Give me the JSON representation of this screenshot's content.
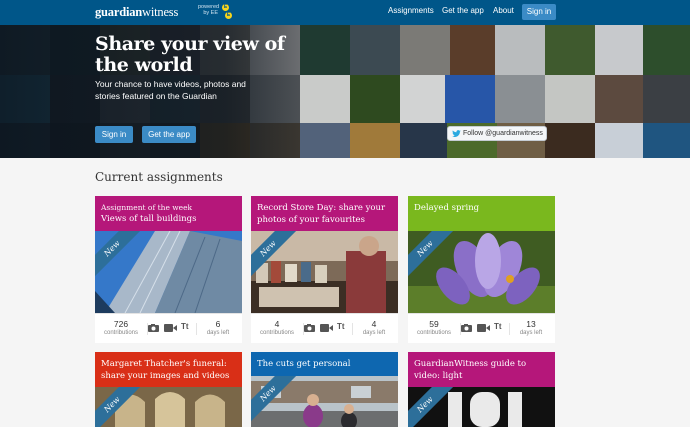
{
  "topbar": {
    "logo_bold": "guardian",
    "logo_thin": "witness",
    "powered_by": "powered by EE",
    "ee_letters": [
      "E",
      "E"
    ],
    "nav": [
      "Assignments",
      "Get the app",
      "About"
    ],
    "signin": "Sign in"
  },
  "hero": {
    "title": "Share your view of the world",
    "subtitle": "Your chance to have videos, photos and stories featured on the Guardian",
    "signin": "Sign in",
    "get_app": "Get the app",
    "follow": "Follow @guardianwitness"
  },
  "section_title": "Current assignments",
  "colors": {
    "topbar": "#005689",
    "button": "#3b8bc6",
    "magenta": "#b5177a",
    "green": "#7ab81e",
    "red": "#d92f17",
    "blue": "#0e67b0"
  },
  "cards": [
    {
      "week": "Assignment of the week",
      "title": "Views of tall buildings",
      "badge": "New",
      "contributions": "726",
      "contributions_label": "contributions",
      "days": "6",
      "days_label": "days left",
      "media": "Tt"
    },
    {
      "week": "",
      "title": "Record Store Day: share your photos of your favourites",
      "badge": "New",
      "contributions": "4",
      "contributions_label": "contributions",
      "days": "4",
      "days_label": "days left",
      "media": "Tt"
    },
    {
      "week": "",
      "title": "Delayed spring",
      "badge": "New",
      "contributions": "59",
      "contributions_label": "contributions",
      "days": "13",
      "days_label": "days left",
      "media": "Tt"
    },
    {
      "week": "",
      "title": "Margaret Thatcher's funeral: share your images and videos",
      "badge": "New"
    },
    {
      "week": "",
      "title": "The cuts get personal",
      "badge": "New"
    },
    {
      "week": "",
      "title": "GuardianWitness guide to video: light",
      "badge": "New"
    }
  ]
}
